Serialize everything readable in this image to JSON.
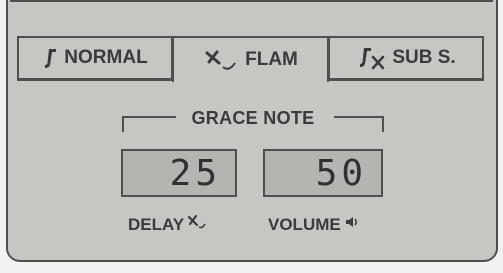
{
  "tabs": [
    {
      "label": "NORMAL",
      "icon": "grace-note-icon",
      "selected": false
    },
    {
      "label": "FLAM",
      "icon": "flam-icon",
      "selected": true
    },
    {
      "label": "SUB S.",
      "icon": "sub-stroke-icon",
      "selected": false
    }
  ],
  "grace": {
    "title": "GRACE NOTE",
    "delay": {
      "value": "25",
      "label": "DELAY",
      "icon": "flam-icon"
    },
    "volume": {
      "value": "50",
      "label": "VOLUME",
      "icon": "speaker-icon"
    }
  },
  "colors": {
    "panel": "#c6c7c3",
    "lcd": "#b4b5b1",
    "outline": "#4e4f4e"
  }
}
